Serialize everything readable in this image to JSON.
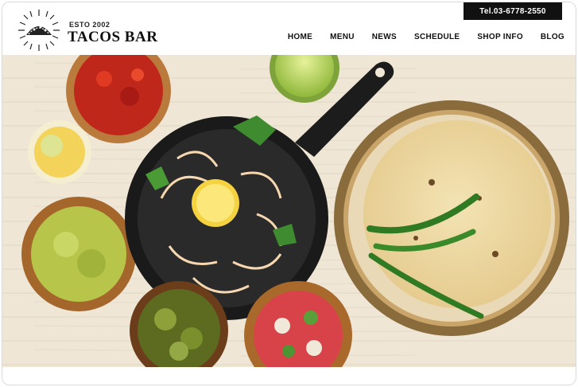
{
  "brand": {
    "established": "ESTO 2002",
    "name": "TACOS BAR"
  },
  "contact": {
    "tel": "Tel.03-6778-2550"
  },
  "nav": {
    "items": [
      {
        "label": "HOME"
      },
      {
        "label": "MENU"
      },
      {
        "label": "NEWS"
      },
      {
        "label": "SCHEDULE"
      },
      {
        "label": "SHOP INFO"
      },
      {
        "label": "BLOG"
      }
    ]
  },
  "colors": {
    "header_bg": "#ffffff",
    "tel_bg": "#111111",
    "text": "#111111",
    "table_wood": "#efe6d6"
  },
  "hero": {
    "icon": "tacos-food-photo"
  }
}
